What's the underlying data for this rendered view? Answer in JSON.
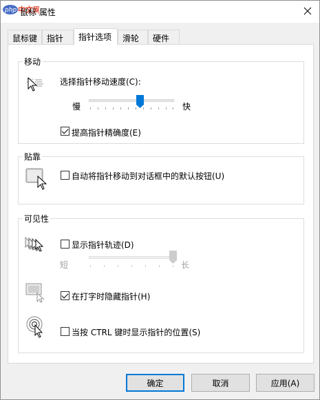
{
  "window": {
    "title": "鼠标 属性",
    "logo_text": "php中文网"
  },
  "tabs": [
    {
      "label": "鼠标键"
    },
    {
      "label": "指针"
    },
    {
      "label": "指针选项"
    },
    {
      "label": "滑轮"
    },
    {
      "label": "硬件"
    }
  ],
  "active_tab": "指针选项",
  "motion": {
    "title": "移动",
    "speed_label": "选择指针移动速度(C):",
    "slow_label": "慢",
    "fast_label": "快",
    "speed_value": 0.6,
    "precision_label": "提高指针精确度(E)",
    "precision_checked": true
  },
  "snap": {
    "title": "贴靠",
    "snap_label": "自动将指针移动到对话框中的默认按钮(U)",
    "snap_checked": false
  },
  "visibility": {
    "title": "可见性",
    "trails_label": "显示指针轨迹(D)",
    "trails_checked": false,
    "short_label": "短",
    "long_label": "长",
    "trails_value": 1.0,
    "hide_label": "在打字时隐藏指针(H)",
    "hide_checked": true,
    "ctrl_label": "当按 CTRL 键时显示指针的位置(S)",
    "ctrl_checked": false
  },
  "buttons": {
    "ok": "确定",
    "cancel": "取消",
    "apply": "应用(A)"
  },
  "colors": {
    "accent": "#0078d7",
    "logo_blue": "#4a6fc7",
    "logo_red": "#e0402a"
  }
}
